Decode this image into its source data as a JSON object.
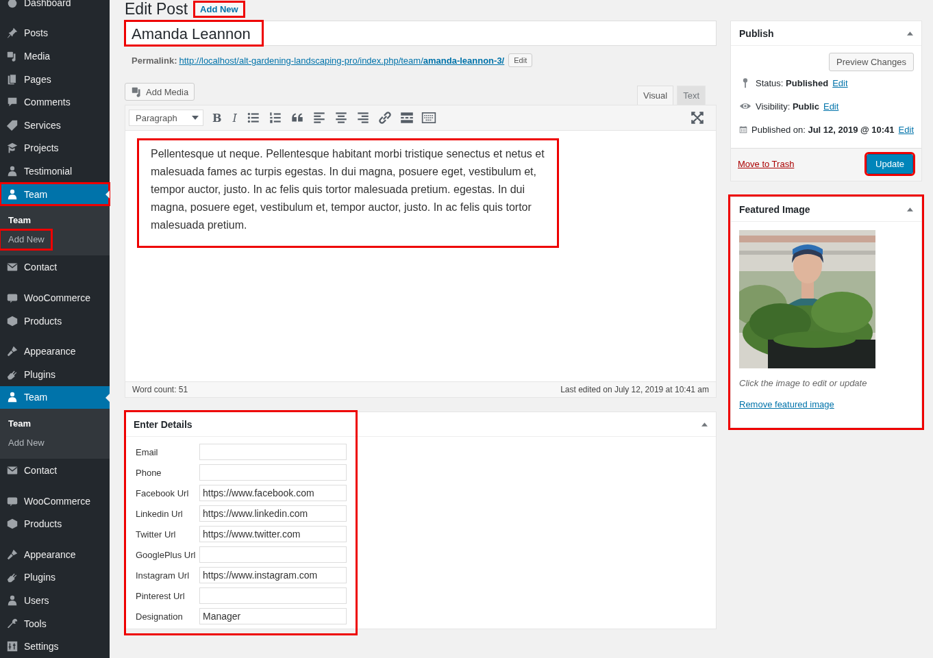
{
  "sidebar": {
    "items": [
      {
        "label": "Dashboard",
        "active": false,
        "highlighted": false,
        "gap_before": false
      },
      {
        "label": "Posts",
        "active": false,
        "highlighted": false,
        "gap_before": true
      },
      {
        "label": "Media",
        "active": false,
        "highlighted": false,
        "gap_before": false
      },
      {
        "label": "Pages",
        "active": false,
        "highlighted": false,
        "gap_before": false
      },
      {
        "label": "Comments",
        "active": false,
        "highlighted": false,
        "gap_before": false
      },
      {
        "label": "Services",
        "active": false,
        "highlighted": false,
        "gap_before": false
      },
      {
        "label": "Projects",
        "active": false,
        "highlighted": false,
        "gap_before": false
      },
      {
        "label": "Testimonial",
        "active": false,
        "highlighted": false,
        "gap_before": false
      },
      {
        "label": "Team",
        "active": true,
        "highlighted": true,
        "gap_before": false,
        "children": [
          {
            "label": "Team",
            "selected": true,
            "highlighted": false
          },
          {
            "label": "Add New",
            "selected": false,
            "highlighted": true
          }
        ]
      },
      {
        "label": "Contact",
        "active": false,
        "highlighted": false,
        "gap_before": false
      },
      {
        "label": "WooCommerce",
        "active": false,
        "highlighted": false,
        "gap_before": true
      },
      {
        "label": "Products",
        "active": false,
        "highlighted": false,
        "gap_before": false
      },
      {
        "label": "Appearance",
        "active": false,
        "highlighted": false,
        "gap_before": true
      },
      {
        "label": "Plugins",
        "active": false,
        "highlighted": false,
        "gap_before": false
      },
      {
        "label": "Team",
        "active": true,
        "highlighted": false,
        "gap_before": false,
        "children": [
          {
            "label": "Team",
            "selected": true,
            "highlighted": false
          },
          {
            "label": "Add New",
            "selected": false,
            "highlighted": false
          }
        ]
      },
      {
        "label": "Contact",
        "active": false,
        "highlighted": false,
        "gap_before": false
      },
      {
        "label": "WooCommerce",
        "active": false,
        "highlighted": false,
        "gap_before": true
      },
      {
        "label": "Products",
        "active": false,
        "highlighted": false,
        "gap_before": false
      },
      {
        "label": "Appearance",
        "active": false,
        "highlighted": false,
        "gap_before": true
      },
      {
        "label": "Plugins",
        "active": false,
        "highlighted": false,
        "gap_before": false
      },
      {
        "label": "Users",
        "active": false,
        "highlighted": false,
        "gap_before": false
      },
      {
        "label": "Tools",
        "active": false,
        "highlighted": false,
        "gap_before": false
      },
      {
        "label": "Settings",
        "active": false,
        "highlighted": false,
        "gap_before": false
      }
    ]
  },
  "heading": {
    "title": "Edit Post",
    "add_new": "Add New",
    "add_new_highlighted": true
  },
  "post": {
    "title": "Amanda Leannon",
    "title_highlighted": true,
    "permalink_label": "Permalink:",
    "permalink_url": "http://localhost/alt-gardening-landscaping-pro/index.php/team/**amanda-leannon-3/**",
    "permalink_edit": "Edit"
  },
  "editor": {
    "add_media": "Add Media",
    "tabs": [
      {
        "label": "Visual",
        "selected": true
      },
      {
        "label": "Text",
        "selected": false
      }
    ],
    "format": "Paragraph",
    "toolbar_letters": [
      "B",
      "I"
    ],
    "content": "Pellentesque ut neque. Pellentesque habitant morbi tristique senectus et netus et malesuada fames ac turpis egestas. In dui magna, posuere eget, vestibulum et, tempor auctor, justo. In ac felis quis tortor malesuada pretium. egestas. In dui magna, posuere eget, vestibulum et, tempor auctor, justo. In ac felis quis tortor malesuada pretium.",
    "content_highlighted": true,
    "word_count": "Word count: 51",
    "last_edited": "Last edited on July 12, 2019 at 10:41 am"
  },
  "details": {
    "title": "Enter Details",
    "highlighted": true,
    "fields": [
      {
        "label": "Email"
      },
      {
        "label": "Phone"
      },
      {
        "label": "Facebook Url",
        "value": "https://www.facebook.com"
      },
      {
        "label": "Linkedin Url",
        "value": "https://www.linkedin.com"
      },
      {
        "label": "Twitter Url",
        "value": "https://www.twitter.com"
      },
      {
        "label": "GooglePlus Url"
      },
      {
        "label": "Instagram Url",
        "value": "https://www.instagram.com"
      },
      {
        "label": "Pinterest Url"
      },
      {
        "label": "Designation",
        "value": "Manager"
      }
    ]
  },
  "publish": {
    "title": "Publish",
    "preview": "Preview Changes",
    "rows": [
      {
        "kind": "status",
        "text": "Status: **Published**",
        "edit": "Edit"
      },
      {
        "kind": "visibility",
        "text": "Visibility: **Public**",
        "edit": "Edit"
      },
      {
        "kind": "date",
        "text": "Published on: **Jul 12, 2019 @ 10:41**",
        "edit": "Edit"
      }
    ],
    "trash": "Move to Trash",
    "update": "Update",
    "update_highlighted": true
  },
  "featured": {
    "title": "Featured Image",
    "highlighted": true,
    "hint": "Click the image to edit or update",
    "remove": "Remove featured image"
  }
}
